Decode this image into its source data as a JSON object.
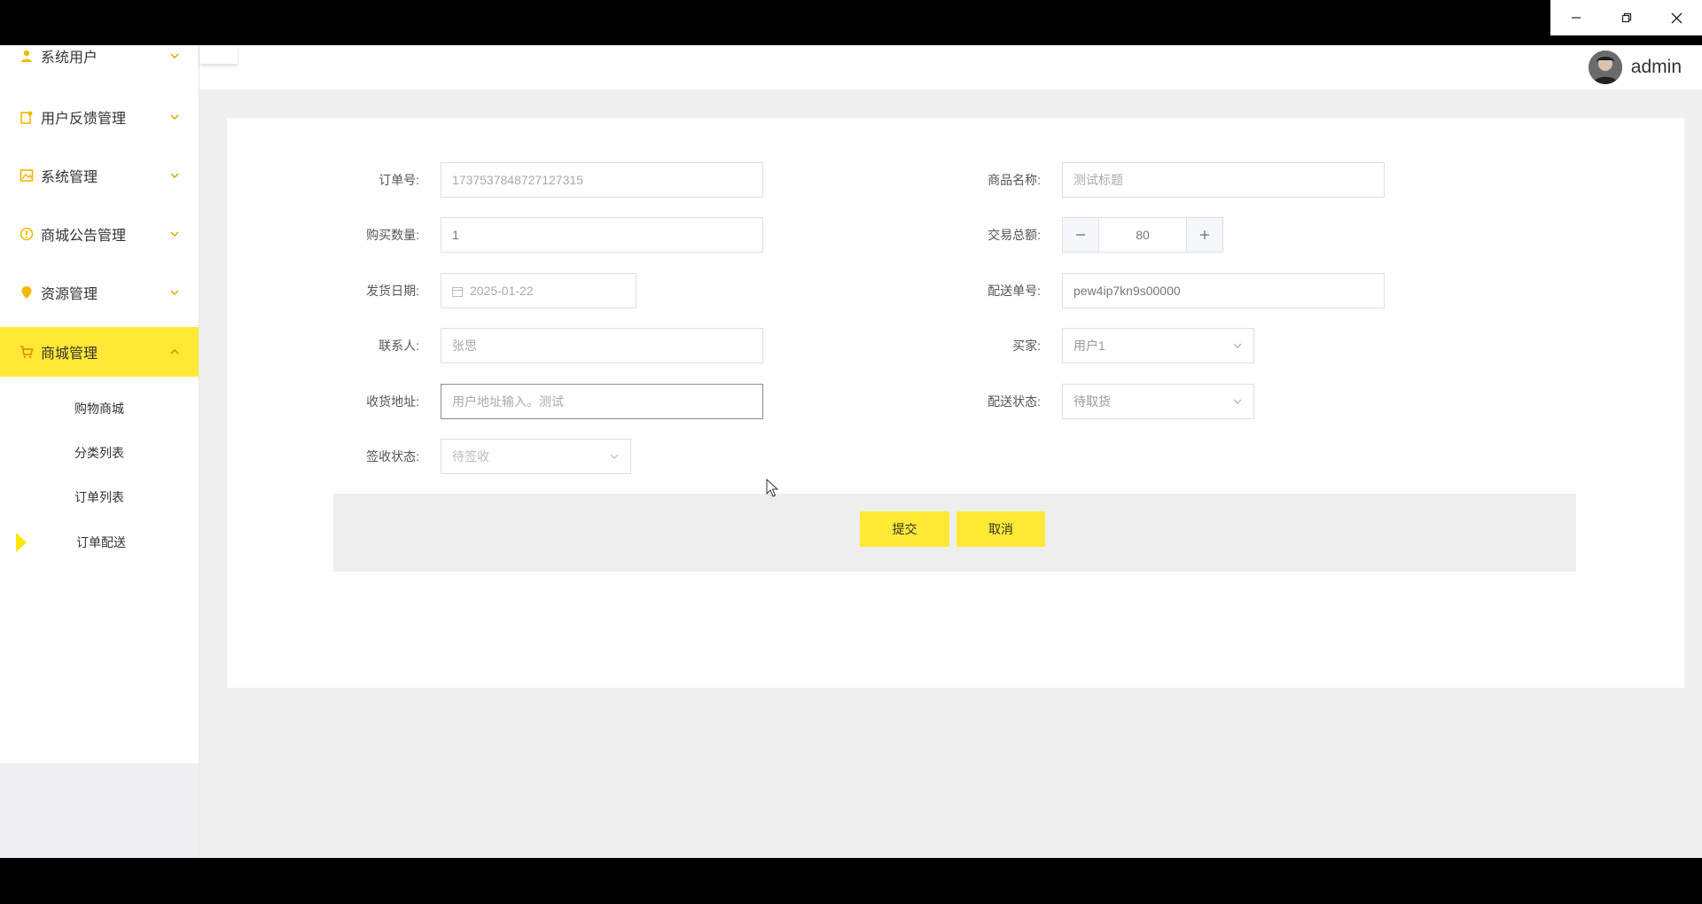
{
  "window": {
    "controls": [
      "minimize",
      "restore",
      "close"
    ]
  },
  "user": {
    "name": "admin"
  },
  "sidebar": {
    "items": [
      {
        "label": "系统用户",
        "icon": "user-icon"
      },
      {
        "label": "用户反馈管理",
        "icon": "feedback-icon"
      },
      {
        "label": "系统管理",
        "icon": "image-icon"
      },
      {
        "label": "商城公告管理",
        "icon": "notice-icon"
      },
      {
        "label": "资源管理",
        "icon": "location-icon"
      },
      {
        "label": "商城管理",
        "icon": "cart-icon",
        "active": true
      }
    ],
    "sub_items": [
      {
        "label": "购物商城"
      },
      {
        "label": "分类列表"
      },
      {
        "label": "订单列表"
      },
      {
        "label": "订单配送",
        "current": true
      }
    ]
  },
  "form": {
    "order_no": {
      "label": "订单号:",
      "value": "1737537848727127315"
    },
    "product_name": {
      "label": "商品名称:",
      "value": "测试标题"
    },
    "quantity": {
      "label": "购买数量:",
      "value": "1"
    },
    "total": {
      "label": "交易总额:",
      "value": "80"
    },
    "ship_date": {
      "label": "发货日期:",
      "value": "2025-01-22"
    },
    "delivery_no": {
      "label": "配送单号:",
      "value": "pew4ip7kn9s00000"
    },
    "contact": {
      "label": "联系人:",
      "value": "张思"
    },
    "buyer": {
      "label": "买家:",
      "value": "用户1"
    },
    "address": {
      "label": "收货地址:",
      "value": "用户地址输入。测试"
    },
    "delivery_status": {
      "label": "配送状态:",
      "value": "待取货"
    },
    "sign_status": {
      "label": "签收状态:",
      "value": "待签收"
    }
  },
  "buttons": {
    "submit": "提交",
    "cancel": "取消"
  },
  "colors": {
    "accent": "#ffe935",
    "marker": "#ffe600"
  }
}
